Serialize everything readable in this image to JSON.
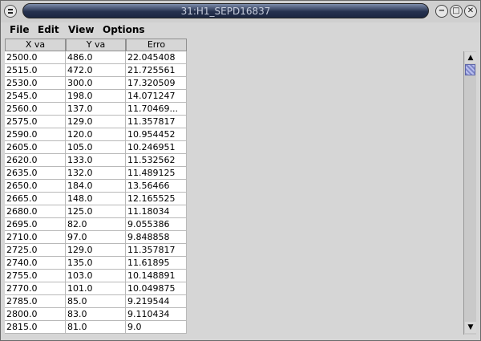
{
  "window": {
    "title": "31:H1_SEPD16837"
  },
  "menu": [
    "File",
    "Edit",
    "View",
    "Options"
  ],
  "table": {
    "columns": [
      "X va",
      "Y va",
      "Erro"
    ],
    "rows": [
      [
        "2500.0",
        "486.0",
        "22.045408"
      ],
      [
        "2515.0",
        "472.0",
        "21.725561"
      ],
      [
        "2530.0",
        "300.0",
        "17.320509"
      ],
      [
        "2545.0",
        "198.0",
        "14.071247"
      ],
      [
        "2560.0",
        "137.0",
        "11.70469..."
      ],
      [
        "2575.0",
        "129.0",
        "11.357817"
      ],
      [
        "2590.0",
        "120.0",
        "10.954452"
      ],
      [
        "2605.0",
        "105.0",
        "10.246951"
      ],
      [
        "2620.0",
        "133.0",
        "11.532562"
      ],
      [
        "2635.0",
        "132.0",
        "11.489125"
      ],
      [
        "2650.0",
        "184.0",
        "13.56466"
      ],
      [
        "2665.0",
        "148.0",
        "12.165525"
      ],
      [
        "2680.0",
        "125.0",
        "11.18034"
      ],
      [
        "2695.0",
        "82.0",
        "9.055386"
      ],
      [
        "2710.0",
        "97.0",
        "9.848858"
      ],
      [
        "2725.0",
        "129.0",
        "11.357817"
      ],
      [
        "2740.0",
        "135.0",
        "11.61895"
      ],
      [
        "2755.0",
        "103.0",
        "10.148891"
      ],
      [
        "2770.0",
        "101.0",
        "10.049875"
      ],
      [
        "2785.0",
        "85.0",
        "9.219544"
      ],
      [
        "2800.0",
        "83.0",
        "9.110434"
      ],
      [
        "2815.0",
        "81.0",
        "9.0"
      ]
    ]
  },
  "window_buttons": {
    "minimize": "−",
    "maximize": "□",
    "close": "✕"
  },
  "scrollbar": {
    "up": "▲",
    "down": "▼"
  },
  "colors": {
    "titlebar": "#26324f",
    "title_text": "#c6ccdc",
    "scroll_thumb": "#7e86c8"
  }
}
